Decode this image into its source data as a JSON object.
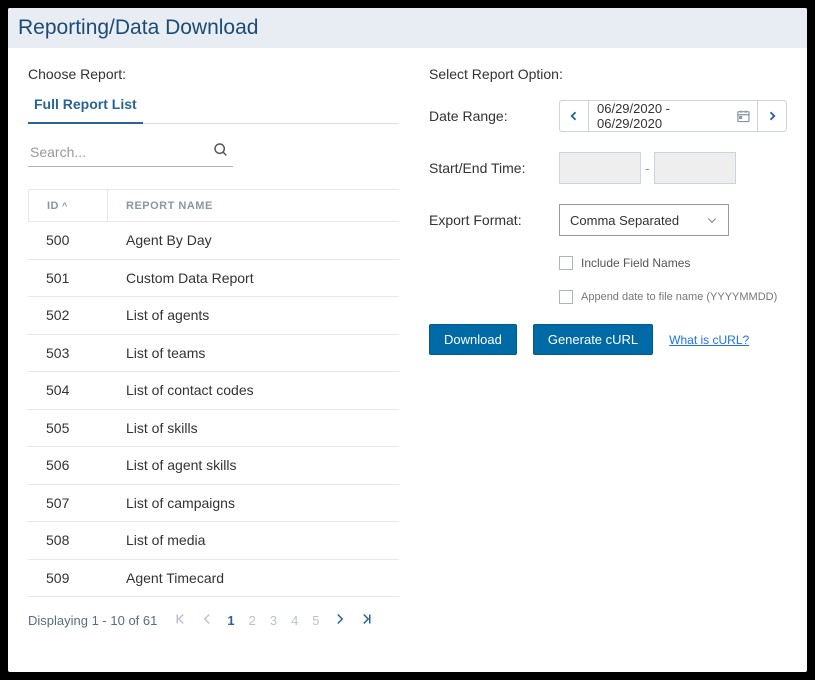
{
  "page": {
    "title": "Reporting/Data Download"
  },
  "left": {
    "choose_label": "Choose Report:",
    "tabs": {
      "full_list": "Full Report List"
    },
    "search_placeholder": "Search...",
    "headers": {
      "id": "ID",
      "name": "REPORT NAME"
    },
    "rows": [
      {
        "id": "500",
        "name": "Agent By Day"
      },
      {
        "id": "501",
        "name": "Custom Data Report"
      },
      {
        "id": "502",
        "name": "List of agents"
      },
      {
        "id": "503",
        "name": "List of teams"
      },
      {
        "id": "504",
        "name": "List of contact codes"
      },
      {
        "id": "505",
        "name": "List of skills"
      },
      {
        "id": "506",
        "name": "List of agent skills"
      },
      {
        "id": "507",
        "name": "List of campaigns"
      },
      {
        "id": "508",
        "name": "List of media"
      },
      {
        "id": "509",
        "name": "Agent Timecard"
      }
    ],
    "pagination": {
      "status": "Displaying 1 - 10 of 61",
      "pages": [
        "1",
        "2",
        "3",
        "4",
        "5"
      ],
      "active_page": "1"
    }
  },
  "right": {
    "section_label": "Select Report Option:",
    "date_range_label": "Date Range:",
    "date_range_value": "06/29/2020 - 06/29/2020",
    "start_end_label": "Start/End Time:",
    "export_label": "Export Format:",
    "export_value": "Comma Separated",
    "include_field_names": "Include Field Names",
    "append_date": "Append date to file name (YYYYMMDD)",
    "download_btn": "Download",
    "curl_btn": "Generate cURL",
    "curl_link": "What is cURL?"
  }
}
